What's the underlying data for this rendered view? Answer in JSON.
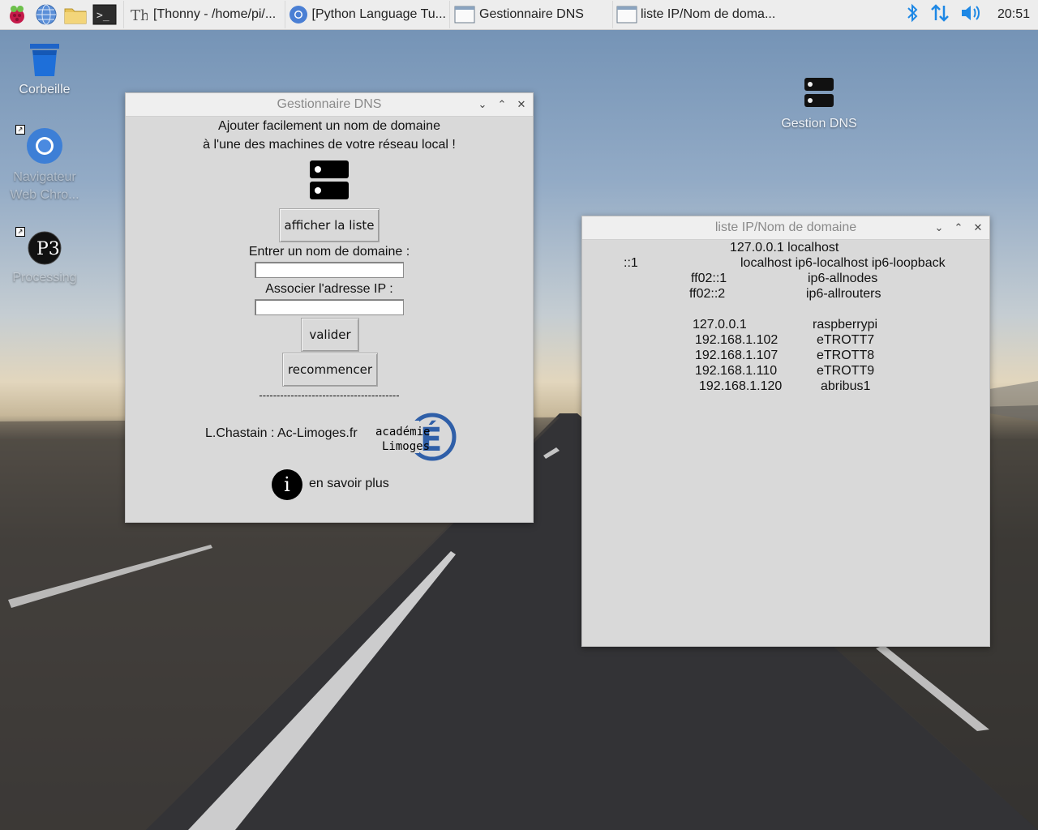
{
  "taskbar": {
    "tasks": [
      {
        "label": "[Thonny  -  /home/pi/...",
        "icon": "thonny-icon"
      },
      {
        "label": "[Python Language Tu...",
        "icon": "chromium-icon"
      },
      {
        "label": "Gestionnaire DNS",
        "icon": "window-icon"
      },
      {
        "label": "liste IP/Nom de doma...",
        "icon": "window-icon"
      }
    ],
    "clock": "20:51"
  },
  "desktop": {
    "icons": [
      {
        "label": "Corbeille"
      },
      {
        "label": "Navigateur Web Chro..."
      },
      {
        "label": "Processing"
      },
      {
        "label": "Gestion DNS"
      }
    ]
  },
  "dns_window": {
    "title": "Gestionnaire DNS",
    "intro_line1": "Ajouter facilement un nom de domaine",
    "intro_line2": "à l'une des machines de votre réseau local !",
    "show_list_label": "afficher la liste",
    "domain_label": "Entrer un nom de domaine :",
    "domain_value": "",
    "ip_label": "Associer l'adresse IP :",
    "ip_value": "",
    "validate_label": "valider",
    "reset_label": "recommencer",
    "separator": "----------------------------------------",
    "credit": "L.Chastain : Ac-Limoges.fr",
    "logo_text_line1": "académie",
    "logo_text_line2": "Limoges",
    "logo_letter": "É",
    "info_label": "en savoir plus"
  },
  "list_window": {
    "title": "liste IP/Nom de domaine",
    "lines": [
      "127.0.0.1  localhost",
      "::1",
      "localhost ip6-localhost ip6-loopback",
      "ff02::1",
      "ip6-allnodes",
      "ff02::2",
      "ip6-allrouters",
      "127.0.0.1",
      "raspberrypi",
      "192.168.1.102",
      "eTROTT7",
      "192.168.1.107",
      "eTROTT8",
      "192.168.1.110",
      "eTROTT9",
      "192.168.1.120",
      "abribus1"
    ]
  },
  "colors": {
    "taskbar_bg": "#ededed",
    "window_bg": "#d9d9d9",
    "accent_blue": "#1e88e5"
  }
}
